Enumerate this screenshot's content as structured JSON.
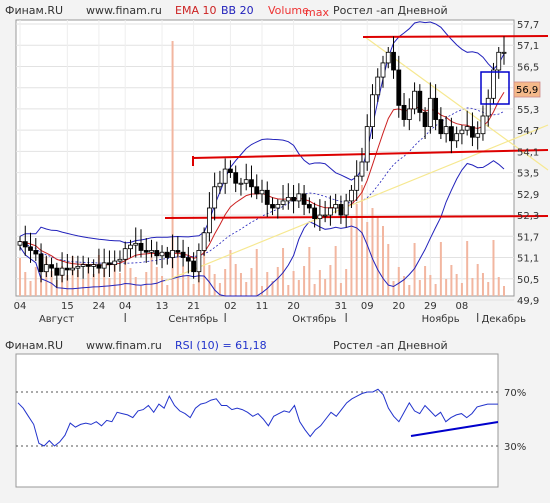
{
  "colors": {
    "background": "#f3f3f3",
    "plot_bg": "#ffffff",
    "grid": "#dddddd",
    "candle": "#000000",
    "ema": "#cc2222",
    "bb": "#2222bb",
    "volume": "#f2b6a0",
    "support_line": "#dd0000",
    "trend_line": "#f6e890",
    "rsi": "#2233cc",
    "rsi_trend": "#0000cc",
    "price_box": "#f4b98a",
    "highlight_box": "#0000cc"
  },
  "main_chart": {
    "header": {
      "source": "Финам.RU",
      "site": "www.finam.ru",
      "ema_label": "EMA 10",
      "bb_label": "BB 20",
      "volume_label": "Volume",
      "max_label": "max",
      "title": "Ростел -ап Дневной"
    },
    "current_price": "56,9",
    "y_ticks": [
      "57,7",
      "57,1",
      "56,5",
      "55,9",
      "55,3",
      "54,7",
      "54,1",
      "53,5",
      "52,9",
      "52,3",
      "51,7",
      "51,1",
      "50,5",
      "49,9"
    ],
    "x_ticks": [
      "04",
      "15",
      "24",
      "04",
      "13",
      "21",
      "02",
      "11",
      "20",
      "31",
      "09",
      "20",
      "29",
      "08"
    ],
    "month_labels": [
      "Август",
      "Сентябрь",
      "Октябрь",
      "Ноябрь",
      "Декабрь"
    ]
  },
  "rsi_chart": {
    "header": {
      "source": "Финам.RU",
      "site": "www.finam.ru",
      "rsi_label": "RSI (10) = 61,18",
      "title": "Ростел -ап Дневной"
    },
    "levels": [
      "70%",
      "30%"
    ]
  },
  "chart_data": [
    {
      "type": "candlestick",
      "title": "Ростел -ап Дневной",
      "ylim": [
        49.9,
        57.7
      ],
      "x": [
        "Aug-04",
        "Aug-05",
        "Aug-06",
        "Aug-07",
        "Aug-08",
        "Aug-11",
        "Aug-12",
        "Aug-13",
        "Aug-14",
        "Aug-15",
        "Aug-18",
        "Aug-19",
        "Aug-20",
        "Aug-21",
        "Aug-22",
        "Aug-25",
        "Aug-26",
        "Aug-27",
        "Aug-28",
        "Aug-29",
        "Sep-01",
        "Sep-02",
        "Sep-03",
        "Sep-04",
        "Sep-05",
        "Sep-08",
        "Sep-09",
        "Sep-10",
        "Sep-11",
        "Sep-12",
        "Sep-15",
        "Sep-16",
        "Sep-17",
        "Sep-18",
        "Sep-19",
        "Sep-22",
        "Sep-23",
        "Sep-24",
        "Sep-25",
        "Sep-26",
        "Sep-29",
        "Sep-30",
        "Oct-01",
        "Oct-02",
        "Oct-03",
        "Oct-06",
        "Oct-07",
        "Oct-08",
        "Oct-09",
        "Oct-10",
        "Oct-13",
        "Oct-14",
        "Oct-15",
        "Oct-16",
        "Oct-17",
        "Oct-20",
        "Oct-21",
        "Oct-22",
        "Oct-23",
        "Oct-24",
        "Oct-27",
        "Oct-28",
        "Oct-29",
        "Oct-30",
        "Oct-31",
        "Nov-03",
        "Nov-05",
        "Nov-06",
        "Nov-07",
        "Nov-10",
        "Nov-11",
        "Nov-12",
        "Nov-13",
        "Nov-14",
        "Nov-17",
        "Nov-18",
        "Nov-19",
        "Nov-20",
        "Nov-21",
        "Nov-24",
        "Nov-25",
        "Nov-26",
        "Nov-27",
        "Nov-28",
        "Dec-01",
        "Dec-02",
        "Dec-03",
        "Dec-04",
        "Dec-05",
        "Dec-08",
        "Dec-09",
        "Dec-10",
        "Dec-11"
      ],
      "close": [
        51.55,
        51.4,
        51.3,
        51.2,
        50.7,
        50.9,
        50.8,
        50.6,
        50.8,
        50.75,
        50.8,
        50.85,
        50.9,
        50.85,
        50.9,
        50.8,
        50.95,
        50.9,
        51.0,
        51.05,
        51.35,
        51.45,
        51.5,
        51.3,
        51.25,
        51.3,
        51.15,
        51.25,
        51.1,
        51.3,
        51.25,
        51.1,
        51.0,
        50.7,
        51.3,
        51.8,
        52.5,
        53.1,
        53.2,
        53.6,
        53.5,
        53.2,
        53.2,
        53.3,
        53.1,
        52.9,
        53.0,
        52.6,
        52.5,
        52.6,
        52.7,
        52.8,
        52.7,
        52.9,
        52.6,
        52.5,
        52.2,
        52.3,
        52.3,
        52.5,
        52.6,
        52.3,
        52.7,
        53.0,
        53.4,
        53.8,
        54.8,
        55.7,
        56.2,
        56.6,
        56.9,
        56.4,
        55.4,
        55.0,
        55.3,
        55.8,
        55.2,
        54.8,
        55.6,
        55.0,
        54.6,
        54.8,
        54.4,
        54.6,
        54.7,
        54.8,
        54.5,
        54.6,
        55.1,
        55.6,
        56.4,
        56.9,
        56.9
      ],
      "bb_upper": [],
      "bb_lower": [],
      "volume": [],
      "horizontal_lines": [
        57.7,
        54.0,
        52.4,
        53.8
      ],
      "max_volume_marker": "max"
    },
    {
      "type": "line",
      "title": "Ростел -ап Дневной",
      "series": [
        {
          "name": "RSI (10)",
          "values": [
            62,
            58,
            52,
            46,
            32,
            30,
            34,
            30,
            33,
            38,
            47,
            44,
            46,
            47,
            46,
            48,
            45,
            49,
            48,
            55,
            54,
            53,
            51,
            56,
            57,
            60,
            55,
            61,
            58,
            67,
            60,
            56,
            54,
            51,
            58,
            61,
            62,
            64,
            65,
            60,
            60,
            57,
            58,
            57,
            55,
            52,
            54,
            50,
            45,
            52,
            54,
            56,
            55,
            60,
            48,
            42,
            37,
            42,
            45,
            50,
            55,
            52,
            57,
            62,
            65,
            67,
            69,
            70,
            70,
            72,
            68,
            58,
            52,
            48,
            55,
            62,
            56,
            54,
            60,
            56,
            52,
            55,
            48,
            51,
            53,
            54,
            51,
            54,
            59,
            60,
            61,
            61,
            61
          ]
        }
      ],
      "ylim": [
        0,
        100
      ],
      "reference_levels": [
        70,
        30
      ],
      "current_value": 61.18
    }
  ]
}
